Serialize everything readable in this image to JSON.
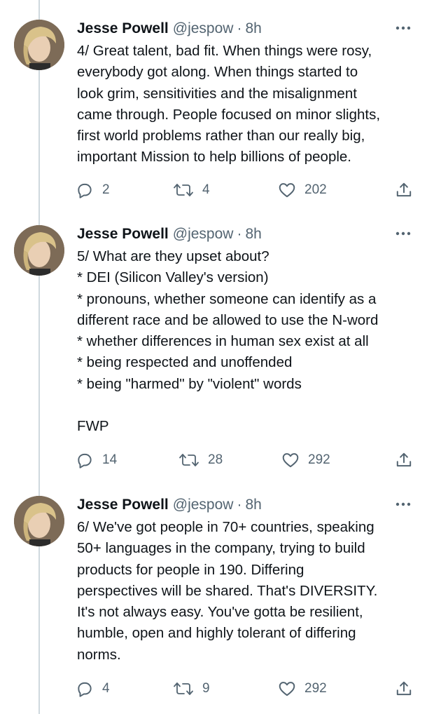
{
  "tweets": [
    {
      "name": "Jesse Powell",
      "handle": "@jespow",
      "dot": "·",
      "time": "8h",
      "lines": [
        "4/ Great talent, bad fit. When things were rosy,",
        "everybody got along. When things started to",
        "look grim, sensitivities and the misalignment",
        "came through. People focused on minor slights,",
        "first world problems rather than our really big,",
        "important Mission to help billions of people."
      ],
      "replies": "2",
      "retweets": "4",
      "likes": "202"
    },
    {
      "name": "Jesse Powell",
      "handle": "@jespow",
      "dot": "·",
      "time": "8h",
      "lines": [
        "5/ What are they upset about?",
        "* DEI (Silicon Valley's version)",
        "* pronouns, whether someone can identify as a",
        "different race and be allowed to use the N-word",
        "* whether differences in human sex exist at all",
        "* being respected and unoffended",
        "* being \"harmed\" by \"violent\" words",
        "",
        "FWP"
      ],
      "replies": "14",
      "retweets": "28",
      "likes": "292"
    },
    {
      "name": "Jesse Powell",
      "handle": "@jespow",
      "dot": "·",
      "time": "8h",
      "lines": [
        "6/ We've got people in 70+ countries, speaking",
        "50+ languages in the company, trying to build",
        "products for people in 190. Differing",
        "perspectives will be shared. That's DIVERSITY.",
        "It's not always easy. You've gotta be resilient,",
        "humble, open and highly tolerant of differing",
        "norms."
      ],
      "replies": "4",
      "retweets": "9",
      "likes": "292"
    }
  ],
  "icons": {
    "reply": "reply-icon",
    "retweet": "retweet-icon",
    "like": "like-icon",
    "share": "share-icon",
    "more": "more-options-icon"
  },
  "colors": {
    "text": "#0f1419",
    "secondary": "#536471",
    "thread_line": "#cfd9de"
  }
}
